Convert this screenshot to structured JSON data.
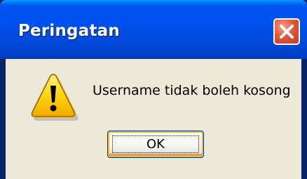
{
  "dialog": {
    "title": "Peringatan",
    "message": "Username tidak boleh kosong",
    "ok_label": "OK",
    "icon": "warning-icon",
    "close_icon": "close-icon"
  },
  "colors": {
    "titlebar": "#0050EE",
    "body": "#ECE9D8",
    "close_button": "#E2583F",
    "warning_yellow": "#FFD60A"
  }
}
